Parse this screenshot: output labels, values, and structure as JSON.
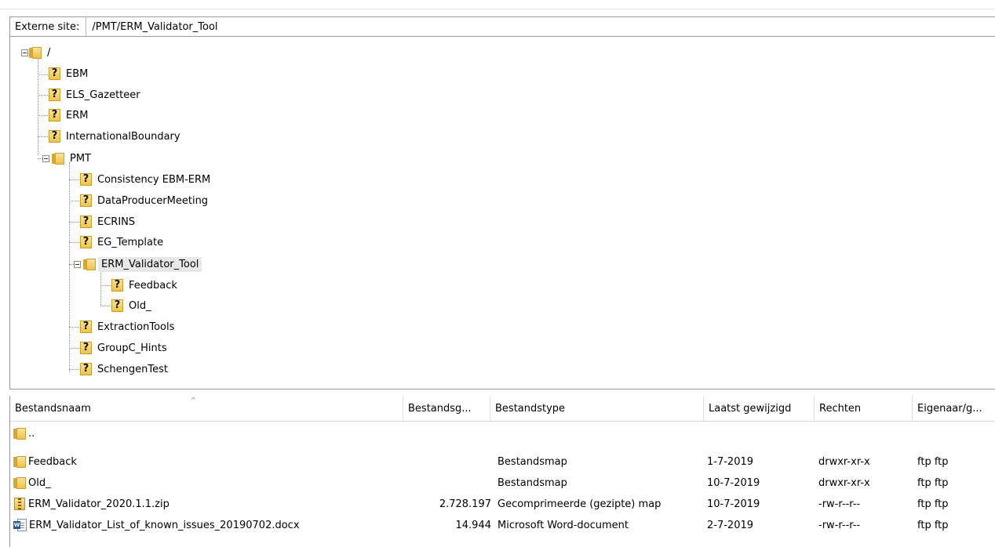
{
  "remote_site": {
    "label": "Externe site:",
    "path": "/PMT/ERM_Validator_Tool"
  },
  "tree": {
    "nodes": [
      {
        "label": "/",
        "icon": "folder-open-icon",
        "expanded": true
      },
      {
        "label": "EBM",
        "icon": "unknown-folder-icon"
      },
      {
        "label": "ELS_Gazetteer",
        "icon": "unknown-folder-icon"
      },
      {
        "label": "ERM",
        "icon": "unknown-folder-icon"
      },
      {
        "label": "InternationalBoundary",
        "icon": "unknown-folder-icon"
      },
      {
        "label": "PMT",
        "icon": "folder-open-icon",
        "expanded": true
      },
      {
        "label": "Consistency EBM-ERM",
        "icon": "unknown-folder-icon"
      },
      {
        "label": "DataProducerMeeting",
        "icon": "unknown-folder-icon"
      },
      {
        "label": "ECRINS",
        "icon": "unknown-folder-icon"
      },
      {
        "label": "EG_Template",
        "icon": "unknown-folder-icon"
      },
      {
        "label": "ERM_Validator_Tool",
        "icon": "folder-open-icon",
        "expanded": true,
        "selected": true
      },
      {
        "label": "Feedback",
        "icon": "unknown-folder-icon"
      },
      {
        "label": "Old_",
        "icon": "unknown-folder-icon"
      },
      {
        "label": "ExtractionTools",
        "icon": "unknown-folder-icon"
      },
      {
        "label": "GroupC_Hints",
        "icon": "unknown-folder-icon"
      },
      {
        "label": "SchengenTest",
        "icon": "unknown-folder-icon"
      }
    ]
  },
  "file_list": {
    "columns": [
      "Bestandsnaam",
      "Bestandsg...",
      "Bestandstype",
      "Laatst gewijzigd",
      "Rechten",
      "Eigenaar/g..."
    ],
    "sort_indicator": "^",
    "rows": [
      {
        "name": "..",
        "size": "",
        "type": "",
        "modified": "",
        "perms": "",
        "owner": "",
        "icon": "folder-icon"
      },
      {
        "name": "Feedback",
        "size": "",
        "type": "Bestandsmap",
        "modified": "1-7-2019",
        "perms": "drwxr-xr-x",
        "owner": "ftp ftp",
        "icon": "folder-icon"
      },
      {
        "name": "Old_",
        "size": "",
        "type": "Bestandsmap",
        "modified": "10-7-2019",
        "perms": "drwxr-xr-x",
        "owner": "ftp ftp",
        "icon": "folder-icon"
      },
      {
        "name": "ERM_Validator_2020.1.1.zip",
        "size": "2.728.197",
        "type": "Gecomprimeerde (gezipte) map",
        "modified": "10-7-2019",
        "perms": "-rw-r--r--",
        "owner": "ftp ftp",
        "icon": "zip-icon"
      },
      {
        "name": "ERM_Validator_List_of_known_issues_20190702.docx",
        "size": "14.944",
        "type": "Microsoft Word-document",
        "modified": "2-7-2019",
        "perms": "-rw-r--r--",
        "owner": "ftp ftp",
        "icon": "word-document-icon"
      }
    ]
  }
}
